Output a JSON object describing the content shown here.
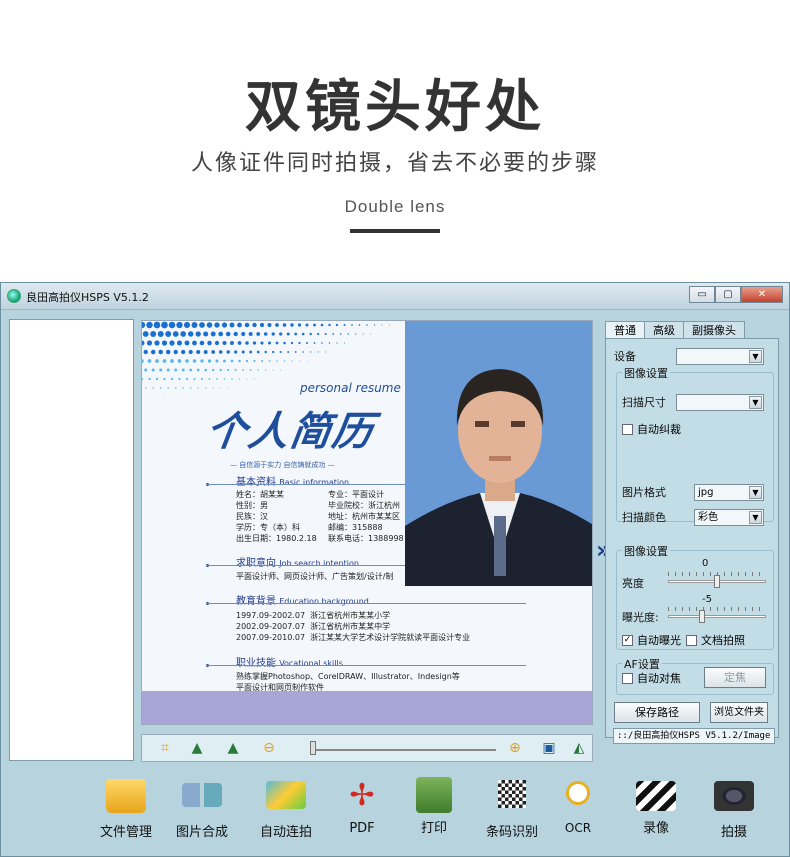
{
  "hero": {
    "title": "双镜头好处",
    "subtitle": "人像证件同时拍摄，省去不必要的步骤",
    "english": "Double lens"
  },
  "window": {
    "title": "良田高拍仪HSPS V5.1.2",
    "minimize": "▭",
    "maximize": "▢",
    "close": "✕"
  },
  "resume": {
    "logo": "个人简历",
    "logo_en": "personal resume",
    "tagline": "— 自信源于实力  自信铸就成功 —",
    "basic_title": "基本资料",
    "basic_title_en": "Basic information",
    "basic_left": "姓名：胡某某\n性别：男\n民族：汉\n学历：专（本）科\n出生日期：1980.2.18",
    "basic_right": "专业：平面设计\n毕业院校：浙江杭州\n地址：杭州市某某区\n邮编：315888\n联系电话：1388998",
    "job_title": "求职意向",
    "job_title_en": "Job search intention",
    "job_text": "平面设计师、网页设计师、广告策划/设计/制",
    "edu_title": "教育背景",
    "edu_title_en": "Education background",
    "edu_text": "1997.09-2002.07  浙江省杭州市某某小学\n2002.09-2007.07  浙江省杭州市某某中学\n2007.09-2010.07  浙江某某大学艺术设计学院就读平面设计专业",
    "skill_title": "职业技能",
    "skill_title_en": "Vocational skills",
    "skill_text": "熟练掌握Photoshop、CorelDRAW、Illustrator、Indesign等\n平面设计和网页制作软件"
  },
  "preview_arrow": "»",
  "tabs": [
    "普通",
    "高级",
    "副摄像头"
  ],
  "settings": {
    "device_label": "设备",
    "device_value": "",
    "image_group": "图像设置",
    "scan_size_label": "扫描尺寸",
    "scan_size_value": "",
    "auto_deskew": "自动纠裁",
    "format_label": "图片格式",
    "format_value": "jpg",
    "color_label": "扫描颜色",
    "color_value": "彩色",
    "image_group2": "图像设置",
    "brightness_label": "亮度",
    "brightness_value": "0",
    "brightness_level": 0.5,
    "exposure_value": "-5",
    "exposure_label": "曝光度:",
    "exposure_level": 0.34,
    "auto_exposure": "自动曝光",
    "auto_exposure_checked": "✓",
    "doc_photo": "文档拍照",
    "af_group": "AF设置",
    "auto_focus": "自动对焦",
    "focus_button": "定焦",
    "save_path_button": "保存路径",
    "browse_button": "浏览文件夹",
    "path": "::/良田高拍仪HSPS V5.1.2/Image"
  },
  "preview_tools": {
    "zoom_level": 0.0
  },
  "bottom": [
    {
      "label": "文件管理",
      "icon": "folder-icon"
    },
    {
      "label": "图片合成",
      "icon": "image-merge-icon"
    },
    {
      "label": "自动连拍",
      "icon": "burst-photos-icon"
    },
    {
      "label": "PDF",
      "icon": "pdf-icon"
    },
    {
      "label": "打印",
      "icon": "printer-icon"
    },
    {
      "label": "条码识别",
      "icon": "qrcode-icon"
    },
    {
      "label": "OCR",
      "icon": "ocr-icon"
    },
    {
      "label": "录像",
      "icon": "clapperboard-icon"
    },
    {
      "label": "拍摄",
      "icon": "camera-icon"
    }
  ]
}
